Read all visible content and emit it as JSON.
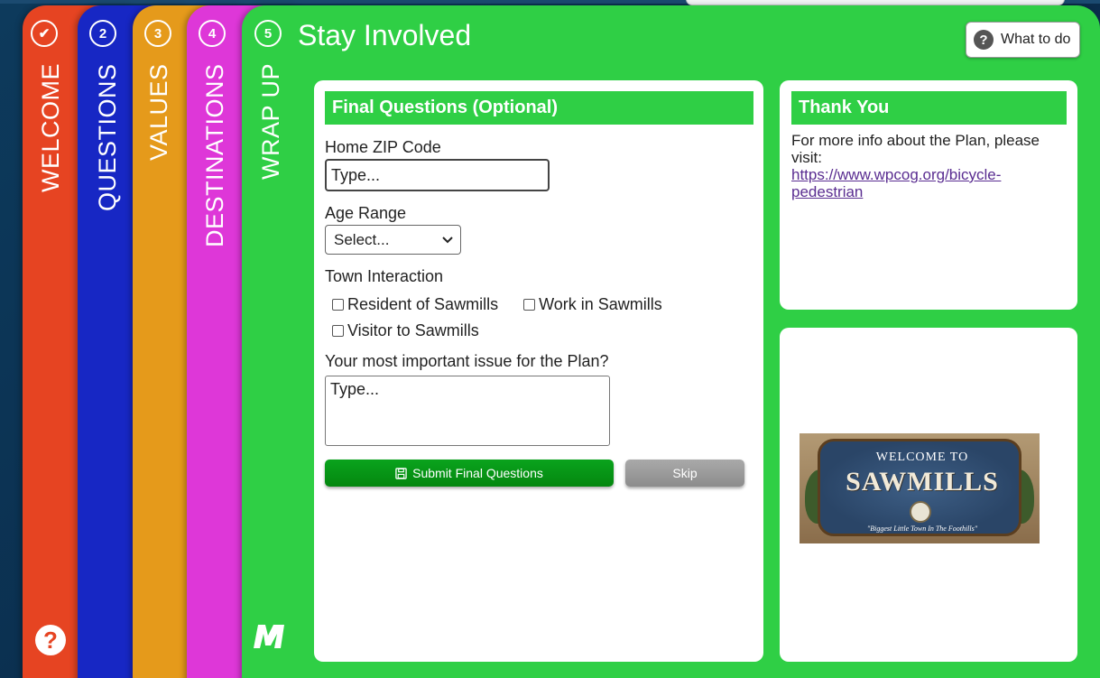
{
  "steps": [
    {
      "badge": "✔",
      "label": "WELCOME"
    },
    {
      "badge": "2",
      "label": "QUESTIONS"
    },
    {
      "badge": "3",
      "label": "VALUES"
    },
    {
      "badge": "4",
      "label": "DESTINATIONS"
    },
    {
      "badge": "5",
      "label": "WRAP UP"
    }
  ],
  "header": {
    "title": "Stay Involved",
    "what_to_do": "What to do"
  },
  "form": {
    "heading": "Final Questions (Optional)",
    "zip_label": "Home ZIP Code",
    "zip_placeholder": "Type...",
    "age_label": "Age Range",
    "age_selected": "Select...",
    "town_label": "Town Interaction",
    "checkboxes": [
      "Resident of Sawmills",
      "Work in Sawmills",
      "Visitor to Sawmills"
    ],
    "issue_label": "Your most important issue for the Plan?",
    "issue_placeholder": "Type...",
    "submit_label": "Submit Final Questions",
    "skip_label": "Skip"
  },
  "thanks": {
    "heading": "Thank You",
    "text": "For more info about the Plan, please visit:",
    "link": "https://www.wpcog.org/bicycle-pedestrian"
  },
  "sign": {
    "welcome": "WELCOME TO",
    "name": "SAWMILLS",
    "tagline": "\"Biggest Little Town In The Foothills\""
  },
  "colors": {
    "welcome": "#e64422",
    "questions": "#1727c4",
    "values": "#e59a1b",
    "destinations": "#de37d8",
    "wrap_up": "#2fcf45",
    "submit": "#04870f",
    "link": "#5a2d91"
  },
  "icons": {
    "help": "question-circle-icon",
    "logo": "m-logo-icon",
    "save": "floppy-disk-icon"
  }
}
